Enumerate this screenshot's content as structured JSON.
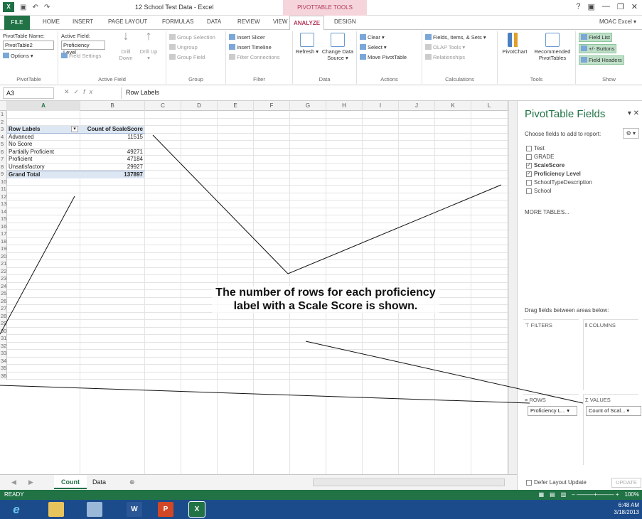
{
  "window": {
    "title": "12 School Test Data - Excel",
    "context_tools": "PIVOTTABLE TOOLS",
    "controls": [
      "?",
      "▣",
      "—",
      "❐",
      "✕"
    ]
  },
  "tabs": [
    "FILE",
    "HOME",
    "INSERT",
    "PAGE LAYOUT",
    "FORMULAS",
    "DATA",
    "REVIEW",
    "VIEW",
    "ANALYZE",
    "DESIGN"
  ],
  "account": "MOAC Excel ▾",
  "ribbon": {
    "pivottable": {
      "name_label": "PivotTable Name:",
      "name_value": "PivotTable2",
      "options": "Options ▾",
      "group": "PivotTable"
    },
    "active_field": {
      "label": "Active Field:",
      "value": "Proficiency Level",
      "field_settings": "Field Settings",
      "drill_down": "Drill Down",
      "drill_up": "Drill Up ▾",
      "group": "Active Field"
    },
    "group": {
      "group_selection": "Group Selection",
      "ungroup": "Ungroup",
      "group_field": "Group Field",
      "group": "Group"
    },
    "filter": {
      "insert_slicer": "Insert Slicer",
      "insert_timeline": "Insert Timeline",
      "filter_connections": "Filter Connections",
      "group": "Filter"
    },
    "data": {
      "refresh": "Refresh ▾",
      "change_source": "Change Data Source ▾",
      "group": "Data"
    },
    "actions": {
      "clear": "Clear ▾",
      "select": "Select ▾",
      "move": "Move PivotTable",
      "group": "Actions"
    },
    "calculations": {
      "fields": "Fields, Items, & Sets ▾",
      "olap": "OLAP Tools ▾",
      "relationships": "Relationships",
      "group": "Calculations"
    },
    "tools": {
      "pivotchart": "PivotChart",
      "recommended": "Recommended PivotTables",
      "group": "Tools"
    },
    "show": {
      "field_list": "Field List",
      "buttons": "+/- Buttons",
      "field_headers": "Field Headers",
      "group": "Show"
    }
  },
  "formula_bar": {
    "name_box": "A3",
    "content": "Row Labels"
  },
  "columns": [
    "A",
    "B",
    "C",
    "D",
    "E",
    "F",
    "G",
    "H",
    "I",
    "J",
    "K",
    "L",
    "M"
  ],
  "rows": [
    "1",
    "2",
    "3",
    "4",
    "5",
    "6",
    "7",
    "8",
    "9",
    "10",
    "11",
    "12",
    "13",
    "14",
    "15",
    "16",
    "17",
    "18",
    "19",
    "20",
    "21",
    "22",
    "23",
    "24",
    "25",
    "26",
    "27",
    "28",
    "29",
    "30",
    "31",
    "32",
    "33",
    "34",
    "35",
    "36"
  ],
  "pivot": {
    "header": [
      "Row Labels",
      "Count of ScaleScore"
    ],
    "rows": [
      [
        "Advanced",
        "11515"
      ],
      [
        "No Score",
        ""
      ],
      [
        "Partially Proficient",
        "49271"
      ],
      [
        "Proficient",
        "47184"
      ],
      [
        "Unsatisfactory",
        "29927"
      ]
    ],
    "total": [
      "Grand Total",
      "137897"
    ]
  },
  "sheet_tabs": [
    "Count",
    "Data"
  ],
  "field_pane": {
    "title": "PivotTable Fields",
    "choose": "Choose fields to add to report:",
    "fields": [
      {
        "name": "Test",
        "checked": false
      },
      {
        "name": "GRADE",
        "checked": false
      },
      {
        "name": "ScaleScore",
        "checked": true
      },
      {
        "name": "Proficiency Level",
        "checked": true
      },
      {
        "name": "SchoolTypeDescription",
        "checked": false
      },
      {
        "name": "School",
        "checked": false
      }
    ],
    "more_tables": "MORE TABLES...",
    "drag_text": "Drag fields between areas below:",
    "areas": {
      "filters": "FILTERS",
      "columns": "COLUMNS",
      "rows": "ROWS",
      "values": "VALUES"
    },
    "rows_chip": "Proficiency L... ▾",
    "values_chip": "Count of Scal... ▾",
    "defer": "Defer Layout Update",
    "update": "UPDATE"
  },
  "status": {
    "ready": "READY",
    "zoom": "100%"
  },
  "taskbar": {
    "time": "6:48 AM",
    "date": "3/18/2013"
  },
  "callout": "The number of rows for each proficiency label with a Scale Score is shown."
}
